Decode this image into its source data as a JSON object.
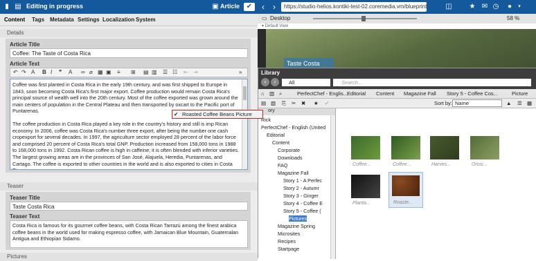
{
  "topbar": {
    "title": "Editing in progress",
    "doc_type": "Article",
    "url": "https://studio-helios.kontiki-test-02.coremedia.vm/blueprint/servlet/perfectchef/magr",
    "colors": {
      "bar": "#14599c"
    }
  },
  "tabs": [
    "Content",
    "Tags",
    "Metadata",
    "Settings",
    "Localization",
    "System"
  ],
  "details": {
    "section": "Details",
    "article_title_label": "Article Title",
    "article_title_value": "Coffee: The Taste of Costa Rica",
    "article_text_label": "Article Text",
    "article_text_p1": "Coffee was first planted in Costa Rica in the early 19th century, and was first shipped to Europe in 1843, soon becoming Costa Rica's first major export. Coffee production would remain Costa Rica's principal source of wealth well into the 20th century. Most of the coffee exported was grown around the main centers of population in the Central Plateau and then transported by oxcart to the Pacific port of Puntarenas.",
    "article_text_p2": "The coffee production in Costa Rica played a key role in the country's history and still is imp Rican economy. In 2006, coffee was Costa Rica's number three export, after being the number one cash cropexport for several decades. In 1997, the agriculture sector employed 28 percent of the labor force and comprised 20 percent of Costa Rica's total GNP. Production increased from 158,000 tons in 1988 to 168,000 tons in 1992. Costa Rican coffee is high in caffeine; it is often blended with inferior varieties. The largest growing areas are in the provinces of San José, Alajuela, Heredia, Puntarenas, and Cartago. The coffee is exported to other countries in the world and is also exported to cities in Costa Rica."
  },
  "teaser": {
    "section": "Teaser",
    "title_label": "Teaser Title",
    "title_value": "Taste Costa Rica",
    "text_label": "Teaser Text",
    "text_value": "Costa Rica is famous for its gourmet coffee beans, with Costa Rican Tarrazú among the finest arabica coffee beans in the world used for making espresso coffee, with Jamaican Blue Mountain, Guatemalan Antigua and Ethiopian Sidamo."
  },
  "pictures_section": "Pictures",
  "preview": {
    "device": "Desktop",
    "zoom": "58 %",
    "default_view": "▾ Default View",
    "hero_title": "Taste Costa Rica"
  },
  "library": {
    "title": "Library",
    "filter": "All",
    "search_placeholder": "Search...",
    "breadcrumb": [
      "PerfectChef - Englis...",
      "Editorial",
      "Content",
      "Magazine Fall",
      "Story 5 - Coffee Cos...",
      "Picture"
    ],
    "sort_label": "Sort by:",
    "sort_value": "Name",
    "tree_header": "ory",
    "tree": [
      {
        "label": "Rick",
        "indent": 0
      },
      {
        "label": "PerfectChef - English (United",
        "indent": 0
      },
      {
        "label": "Editorial",
        "indent": 1
      },
      {
        "label": "Content",
        "indent": 2
      },
      {
        "label": "Corporate",
        "indent": 3
      },
      {
        "label": "Downloads",
        "indent": 3
      },
      {
        "label": "FAQ",
        "indent": 3
      },
      {
        "label": "Magazine Fall",
        "indent": 3
      },
      {
        "label": "Story 1 - A Perfec",
        "indent": 4
      },
      {
        "label": "Story 2 - Autumr",
        "indent": 4
      },
      {
        "label": "Story 3 - Ginger",
        "indent": 4
      },
      {
        "label": "Story 4 - Coffee E",
        "indent": 4
      },
      {
        "label": "Story 5 - Coffee (",
        "indent": 4
      },
      {
        "label": "Pictures",
        "indent": 5
      },
      {
        "label": "Magazine Spring",
        "indent": 3
      },
      {
        "label": "Microsites",
        "indent": 3
      },
      {
        "label": "Recipes",
        "indent": 3
      },
      {
        "label": "Startpage",
        "indent": 3
      }
    ],
    "thumbnails": [
      "Coffee...",
      "Coffee...",
      "Harves...",
      "Orosi...",
      "Planta...",
      "Roaste..."
    ],
    "drag_tooltip": "Roasted Coffee Beans Picture"
  }
}
